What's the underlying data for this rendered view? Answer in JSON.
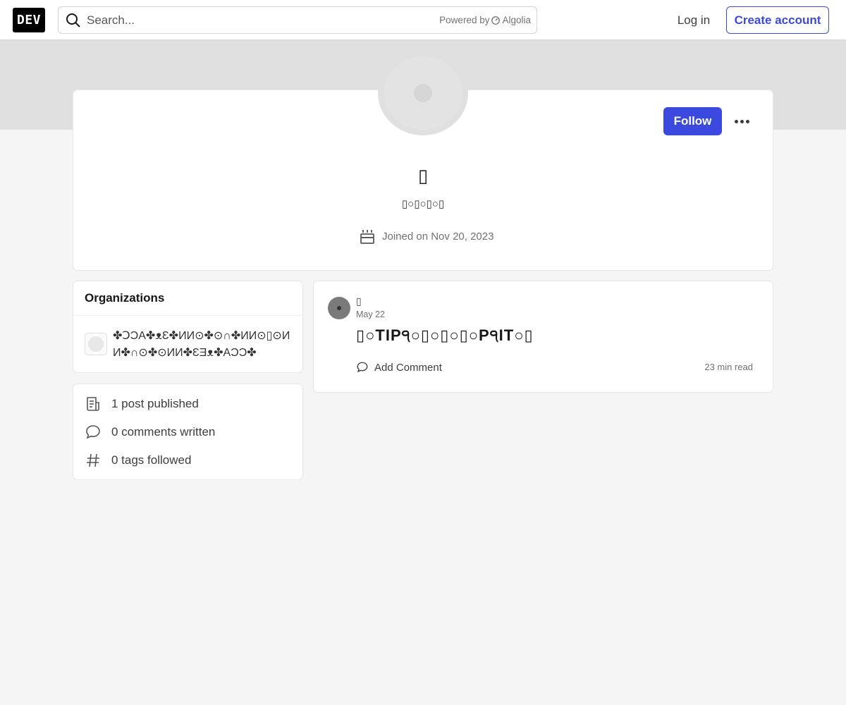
{
  "header": {
    "logo_text": "DEV",
    "search_placeholder": "Search...",
    "powered_by": "Powered by",
    "algolia": "Algolia",
    "login_label": "Log in",
    "create_account_label": "Create account"
  },
  "profile": {
    "name": "▯",
    "bio": "▯○▯○▯○▯",
    "joined": "Joined on Nov 20, 2023",
    "follow_label": "Follow"
  },
  "sidebar": {
    "organizations_title": "Organizations",
    "org_name": "✤ↃƆA✤ᴥƐ✤ИИ⊙✤⊙∩✤ИИ⊙▯⊙ИИ✤∩⊙✤⊙ИИ✤ƐƎᴥ✤AƆƆ✤",
    "stats": [
      {
        "icon": "post-icon",
        "label": "1 post published"
      },
      {
        "icon": "comment-icon",
        "label": "0 comments written"
      },
      {
        "icon": "hashtag-icon",
        "label": "0 tags followed"
      }
    ]
  },
  "post": {
    "author": "▯",
    "date": "May 22",
    "title": "▯○TIP੧○▯○▯○▯○P੧IT○▯",
    "add_comment_label": "Add Comment",
    "read_time": "23 min read"
  },
  "colors": {
    "accent": "#3b49df",
    "background": "#f5f5f5",
    "banner": "#e0e0e0"
  }
}
